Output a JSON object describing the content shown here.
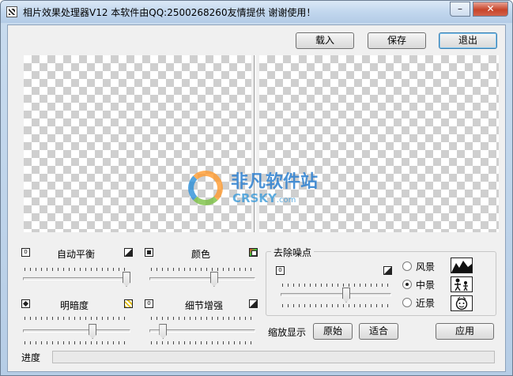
{
  "window": {
    "title": "相片效果处理器V12  本软件由QQ:2500268260友情提供 谢谢使用！",
    "minimize_glyph": "–",
    "close_glyph": "✕"
  },
  "toolbar": {
    "load_label": "载入",
    "save_label": "保存",
    "exit_label": "退出"
  },
  "watermark": {
    "line1": "非凡软件站",
    "line2": "CRSKY",
    "line2_suffix": ".com"
  },
  "sliders": {
    "auto_balance": {
      "label": "自动平衡",
      "left_icon": "sun-small-icon",
      "right_icon": "contrast-icon",
      "value": 1.0
    },
    "color": {
      "label": "颜色",
      "left_icon": "grayscale-icon",
      "right_icon": "color-icon",
      "value": 0.62
    },
    "brightness": {
      "label": "明暗度",
      "left_icon": "dark-icon",
      "right_icon": "bright-icon",
      "value": 0.66
    },
    "detail": {
      "label": "细节增强",
      "left_icon": "detail-low-icon",
      "right_icon": "detail-high-icon",
      "value": 0.1
    }
  },
  "denoise": {
    "title": "去除噪点",
    "value": 0.6,
    "options": [
      {
        "label": "风景",
        "selected": false,
        "icon": "landscape-icon"
      },
      {
        "label": "中景",
        "selected": true,
        "icon": "people-icon"
      },
      {
        "label": "近景",
        "selected": false,
        "icon": "closeup-icon"
      }
    ]
  },
  "zoom": {
    "label": "缩放显示",
    "original_label": "原始",
    "fit_label": "适合"
  },
  "apply_label": "应用",
  "progress": {
    "label": "进度",
    "value": 0
  }
}
